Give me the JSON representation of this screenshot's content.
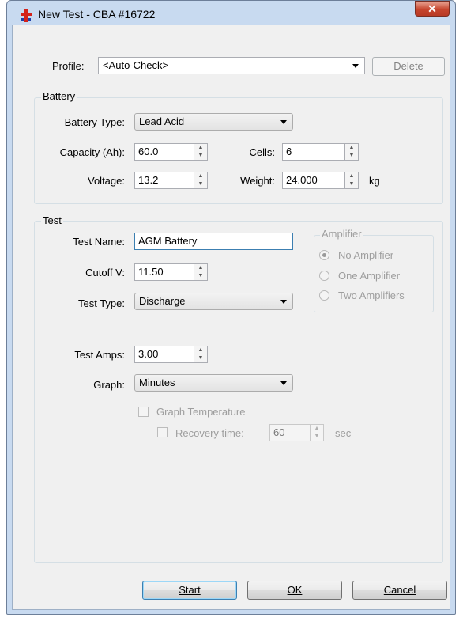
{
  "window": {
    "title": "New Test - CBA #16722",
    "close_glyph": "✕",
    "icon": "red-cross-icon"
  },
  "profile": {
    "label": "Profile:",
    "value": "<Auto-Check>",
    "delete_label": "Delete"
  },
  "battery": {
    "group_title": "Battery",
    "type_label": "Battery Type:",
    "type_value": "Lead Acid",
    "capacity_label": "Capacity (Ah):",
    "capacity_value": "60.0",
    "cells_label": "Cells:",
    "cells_value": "6",
    "voltage_label": "Voltage:",
    "voltage_value": "13.2",
    "weight_label": "Weight:",
    "weight_value": "24.000",
    "weight_unit": "kg"
  },
  "test": {
    "group_title": "Test",
    "name_label": "Test Name:",
    "name_value": "AGM Battery",
    "cutoff_label": "Cutoff V:",
    "cutoff_value": "11.50",
    "type_label": "Test Type:",
    "type_value": "Discharge",
    "amps_label": "Test Amps:",
    "amps_value": "3.00",
    "graph_label": "Graph:",
    "graph_value": "Minutes",
    "graph_temp_label": "Graph Temperature",
    "recovery_label": "Recovery time:",
    "recovery_value": "60",
    "recovery_unit": "sec"
  },
  "amplifier": {
    "group_title": "Amplifier",
    "options": [
      "No Amplifier",
      "One Amplifier",
      "Two Amplifiers"
    ],
    "selected": "No Amplifier"
  },
  "buttons": {
    "start": "Start",
    "ok": "OK",
    "cancel": "Cancel"
  },
  "colors": {
    "frame": "#c8daf0",
    "close_button": "#c6452e",
    "icon_red": "#d4221a",
    "icon_blue": "#1f3fa8"
  }
}
